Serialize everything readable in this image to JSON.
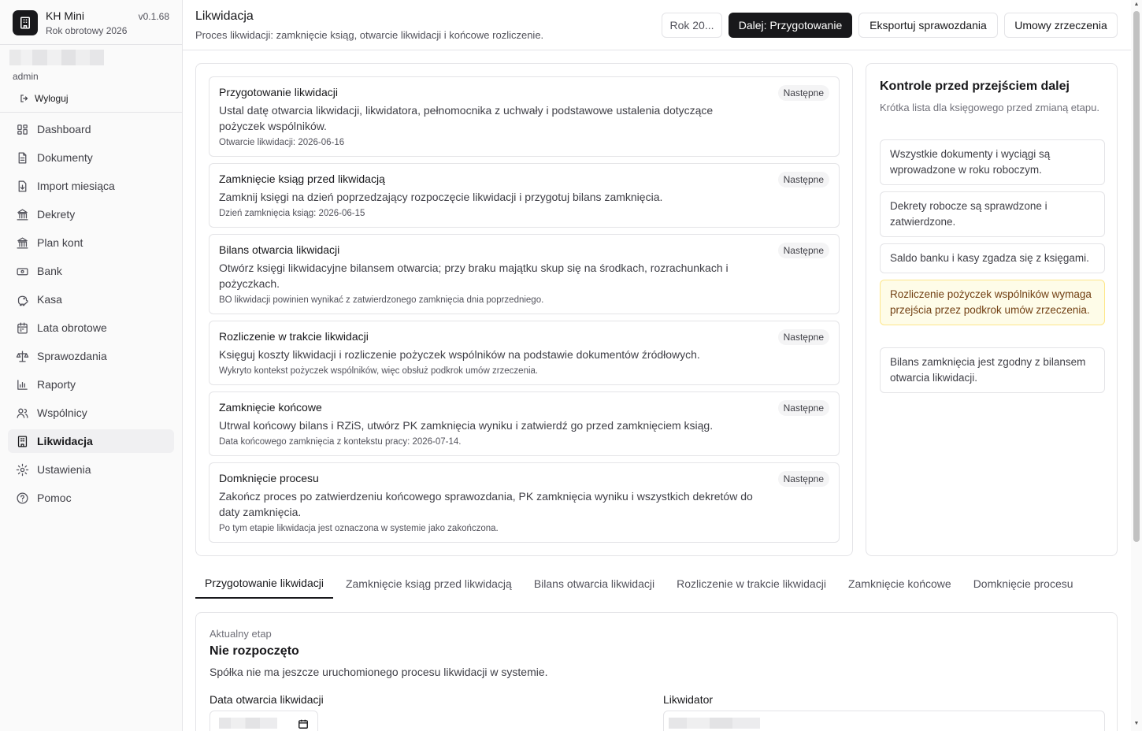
{
  "app": {
    "name": "KH Mini",
    "version": "v0.1.68",
    "fiscal_year": "Rok obrotowy 2026"
  },
  "user": {
    "role": "admin",
    "logout_label": "Wyloguj"
  },
  "nav": [
    {
      "label": "Dashboard",
      "icon": "dashboard-icon"
    },
    {
      "label": "Dokumenty",
      "icon": "document-icon"
    },
    {
      "label": "Import miesiąca",
      "icon": "import-icon"
    },
    {
      "label": "Dekrety",
      "icon": "landmark-icon"
    },
    {
      "label": "Plan kont",
      "icon": "landmark-icon"
    },
    {
      "label": "Bank",
      "icon": "banknote-icon"
    },
    {
      "label": "Kasa",
      "icon": "piggy-bank-icon"
    },
    {
      "label": "Lata obrotowe",
      "icon": "calendar-icon"
    },
    {
      "label": "Sprawozdania",
      "icon": "scale-icon"
    },
    {
      "label": "Raporty",
      "icon": "bar-chart-icon"
    },
    {
      "label": "Wspólnicy",
      "icon": "users-icon"
    },
    {
      "label": "Likwidacja",
      "icon": "building-icon",
      "active": true
    },
    {
      "label": "Ustawienia",
      "icon": "gear-icon"
    },
    {
      "label": "Pomoc",
      "icon": "help-icon"
    }
  ],
  "header": {
    "title": "Likwidacja",
    "description": "Proces likwidacji: zamknięcie ksiąg, otwarcie likwidacji i końcowe rozliczenie.",
    "year_select": "Rok 20...",
    "next_button": "Dalej: Przygotowanie",
    "export_button": "Eksportuj sprawozdania",
    "agreements_button": "Umowy zrzeczenia"
  },
  "steps": [
    {
      "title": "Przygotowanie likwidacji",
      "badge": "Następne",
      "description": "Ustal datę otwarcia likwidacji, likwidatora, pełnomocnika z uchwały i podstawowe ustalenia dotyczące pożyczek wspólników.",
      "meta": "Otwarcie likwidacji: 2026-06-16"
    },
    {
      "title": "Zamknięcie ksiąg przed likwidacją",
      "badge": "Następne",
      "description": "Zamknij księgi na dzień poprzedzający rozpoczęcie likwidacji i przygotuj bilans zamknięcia.",
      "meta": "Dzień zamknięcia ksiąg: 2026-06-15"
    },
    {
      "title": "Bilans otwarcia likwidacji",
      "badge": "Następne",
      "description": "Otwórz księgi likwidacyjne bilansem otwarcia; przy braku majątku skup się na środkach, rozrachunkach i pożyczkach.",
      "meta": "BO likwidacji powinien wynikać z zatwierdzonego zamknięcia dnia poprzedniego."
    },
    {
      "title": "Rozliczenie w trakcie likwidacji",
      "badge": "Następne",
      "description": "Księguj koszty likwidacji i rozliczenie pożyczek wspólników na podstawie dokumentów źródłowych.",
      "meta": "Wykryto kontekst pożyczek wspólników, więc obsłuż podkrok umów zrzeczenia."
    },
    {
      "title": "Zamknięcie końcowe",
      "badge": "Następne",
      "description": "Utrwal końcowy bilans i RZiS, utwórz PK zamknięcia wyniku i zatwierdź go przed zamknięciem ksiąg.",
      "meta": "Data końcowego zamknięcia z kontekstu pracy: 2026-07-14."
    },
    {
      "title": "Domknięcie procesu",
      "badge": "Następne",
      "description": "Zakończ proces po zatwierdzeniu końcowego sprawozdania, PK zamknięcia wyniku i wszystkich dekretów do daty zamknięcia.",
      "meta": "Po tym etapie likwidacja jest oznaczona w systemie jako zakończona."
    }
  ],
  "checks": {
    "title": "Kontrole przed przejściem dalej",
    "subtitle": "Krótka lista dla księgowego przed zmianą etapu.",
    "items": [
      {
        "text": "Wszystkie dokumenty i wyciągi są wprowadzone w roku roboczym."
      },
      {
        "text": "Dekrety robocze są sprawdzone i zatwierdzone."
      },
      {
        "text": "Saldo banku i kasy zgadza się z księgami."
      },
      {
        "text": "Rozliczenie pożyczek wspólników wymaga przejścia przez podkrok umów zrzeczenia.",
        "warning": true
      },
      {
        "text": "Bilans zamknięcia jest zgodny z bilansem otwarcia likwidacji."
      }
    ]
  },
  "tabs": [
    {
      "label": "Przygotowanie likwidacji",
      "active": true
    },
    {
      "label": "Zamknięcie ksiąg przed likwidacją"
    },
    {
      "label": "Bilans otwarcia likwidacji"
    },
    {
      "label": "Rozliczenie w trakcie likwidacji"
    },
    {
      "label": "Zamknięcie końcowe"
    },
    {
      "label": "Domknięcie procesu"
    }
  ],
  "stage": {
    "label": "Aktualny etap",
    "value": "Nie rozpoczęto",
    "description": "Spółka nie ma jeszcze uruchomionego procesu likwidacji w systemie.",
    "date_label": "Data otwarcia likwidacji",
    "liquidator_label": "Likwidator"
  }
}
